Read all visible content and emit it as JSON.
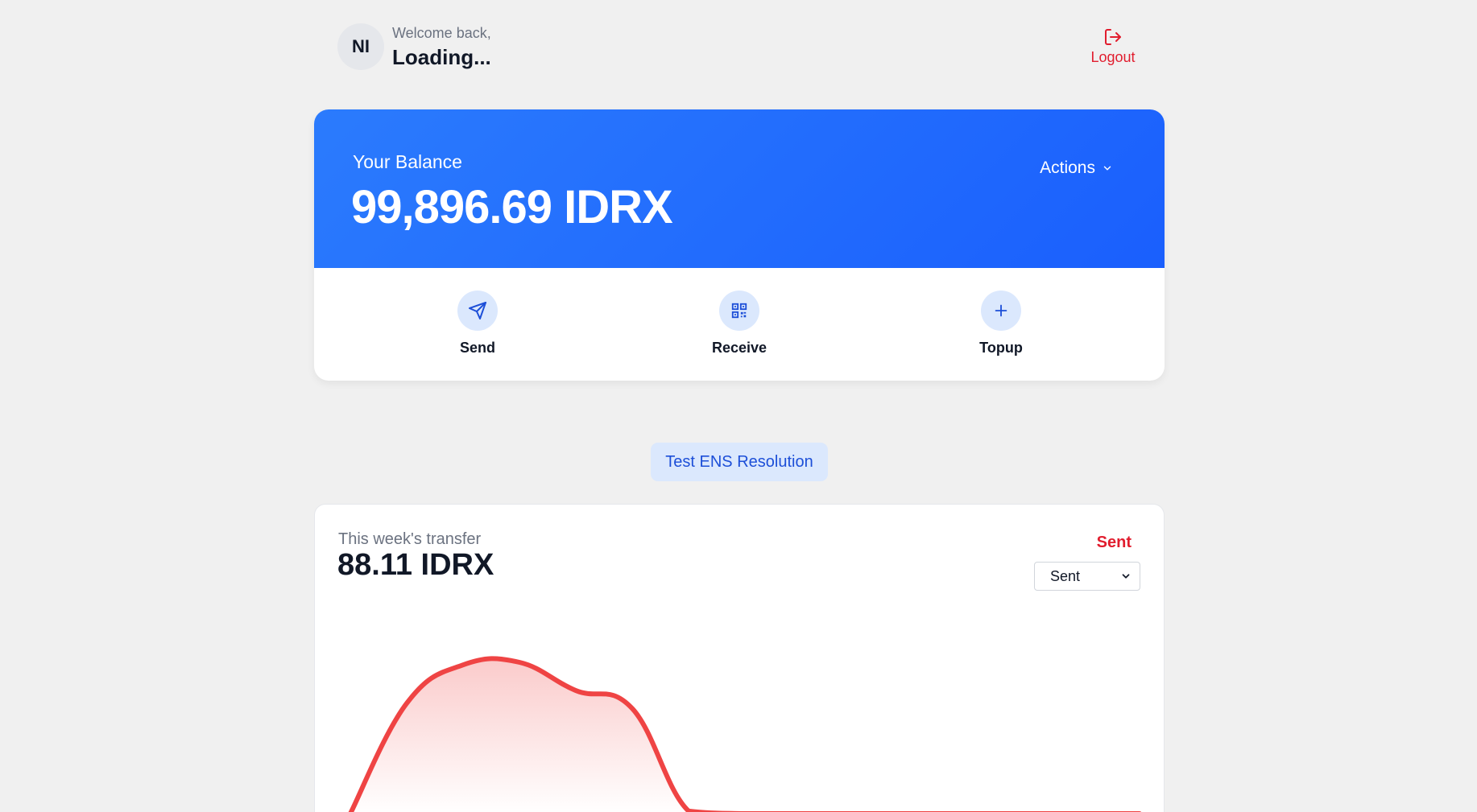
{
  "header": {
    "avatar_initials": "NI",
    "welcome_text": "Welcome back,",
    "username": "Loading...",
    "logout_label": "Logout"
  },
  "balance": {
    "label": "Your Balance",
    "amount": "99,896.69 IDRX",
    "actions_label": "Actions"
  },
  "quick_actions": [
    {
      "label": "Send",
      "icon": "send-icon"
    },
    {
      "label": "Receive",
      "icon": "qr-code-icon"
    },
    {
      "label": "Topup",
      "icon": "plus-icon"
    }
  ],
  "ens_button_label": "Test ENS Resolution",
  "transfer": {
    "label": "This week's transfer",
    "amount": "88.11 IDRX",
    "filter_title": "Sent",
    "filter_value": "Sent",
    "line_color": "#ef4444"
  },
  "chart_data": {
    "type": "area",
    "title": "",
    "xlabel": "",
    "ylabel": "",
    "series": [
      {
        "values": [
          0,
          43,
          58,
          59,
          48,
          41,
          1,
          0,
          0,
          0,
          0,
          0,
          0,
          0,
          0
        ]
      }
    ]
  }
}
